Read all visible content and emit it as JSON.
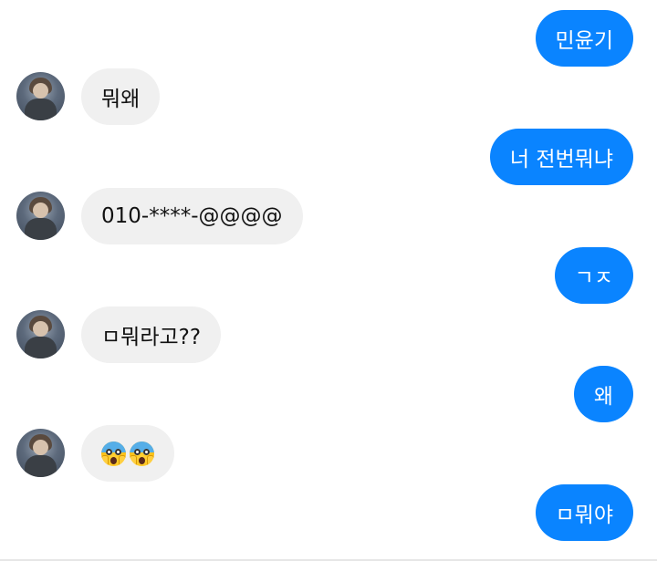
{
  "messages": [
    {
      "dir": "out",
      "text": "민윤기"
    },
    {
      "dir": "in",
      "text": "뭐왜"
    },
    {
      "dir": "out",
      "text": "너 전번뭐냐"
    },
    {
      "dir": "in",
      "text": "010-****-@@@@"
    },
    {
      "dir": "out",
      "text": "ㄱㅈ"
    },
    {
      "dir": "in",
      "text": "ㅁ뭐라고??"
    },
    {
      "dir": "out",
      "text": "왜"
    },
    {
      "dir": "in",
      "emoji": [
        "face-screaming-in-fear-icon",
        "face-screaming-in-fear-icon"
      ]
    },
    {
      "dir": "out",
      "text": "ㅁ뭐야"
    }
  ],
  "colors": {
    "outgoing_bubble": "#0a84ff",
    "incoming_bubble": "#f0f0f0"
  },
  "avatar_icon": "profile-photo-avatar"
}
